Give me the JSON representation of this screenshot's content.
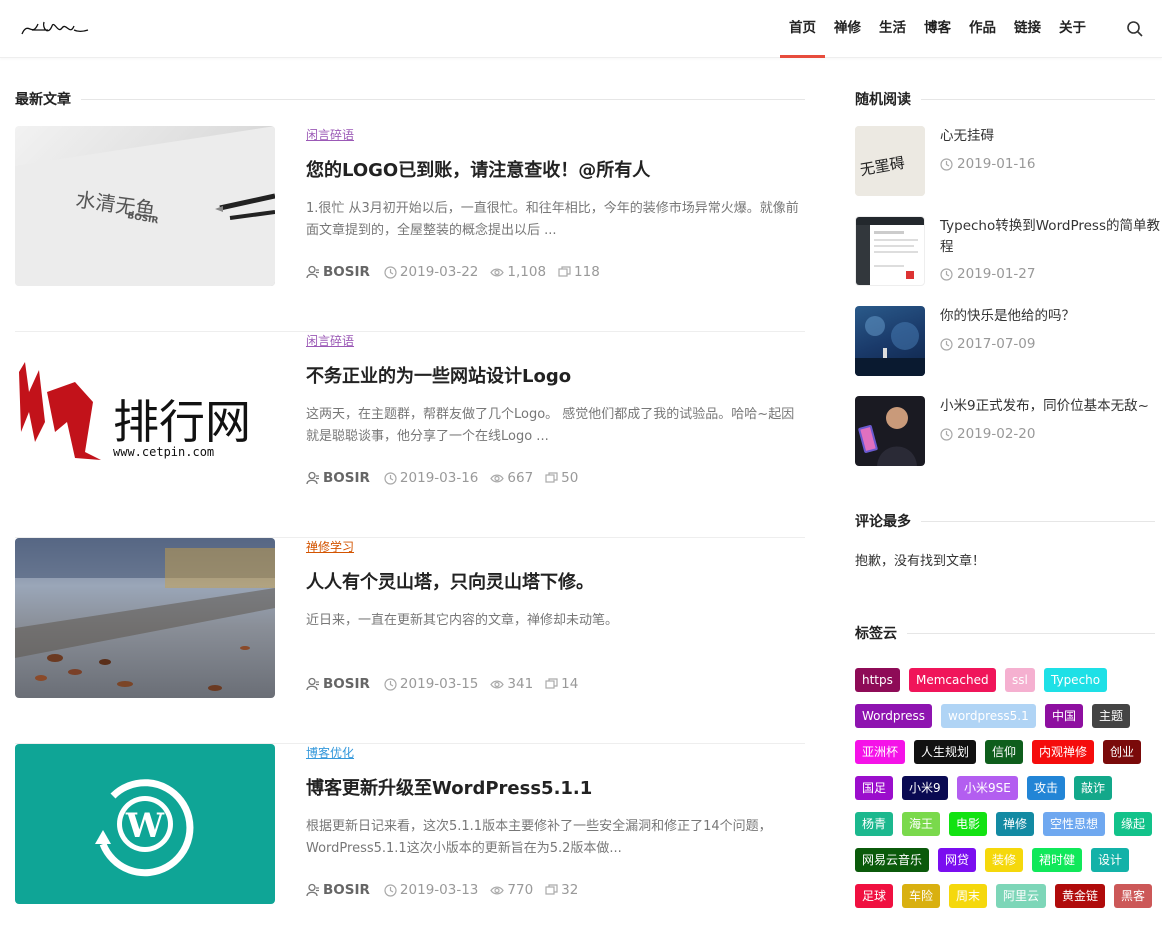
{
  "header": {
    "nav": [
      "首页",
      "禅修",
      "生活",
      "博客",
      "作品",
      "链接",
      "关于"
    ],
    "active_index": 0
  },
  "main": {
    "section_title": "最新文章",
    "posts": [
      {
        "category": "闲言碎语",
        "category_color": "#9b59b6",
        "title": "您的LOGO已到账，请注意查收！@所有人",
        "excerpt": "1.很忙 从3月初开始以后，一直很忙。和往年相比，今年的装修市场异常火爆。就像前面文章提到的，全屋整装的概念提出以后 ...",
        "author": "BOSIR",
        "date": "2019-03-22",
        "views": "1,108",
        "comments": "118",
        "thumb_text": "水清无鱼",
        "thumb_subtext": "BOSIR"
      },
      {
        "category": "闲言碎语",
        "category_color": "#9b59b6",
        "title": "不务正业的为一些网站设计Logo",
        "excerpt": "这两天，在主题群，帮群友做了几个Logo。 感觉他们都成了我的试验品。哈哈~起因就是聪聪谈事，他分享了一个在线Logo ...",
        "author": "BOSIR",
        "date": "2019-03-16",
        "views": "667",
        "comments": "50",
        "thumb_text": "排行网",
        "thumb_subtext": "www.cetpin.com"
      },
      {
        "category": "禅修学习",
        "category_color": "#d35400",
        "title": "人人有个灵山塔，只向灵山塔下修。",
        "excerpt": "近日来，一直在更新其它内容的文章，禅修却未动笔。",
        "author": "BOSIR",
        "date": "2019-03-15",
        "views": "341",
        "comments": "14"
      },
      {
        "category": "博客优化",
        "category_color": "#3498db",
        "title": "博客更新升级至WordPress5.1.1",
        "excerpt": "根据更新日记来看，这次5.1.1版本主要修补了一些安全漏洞和修正了14个问题，WordPress5.1.1这次小版本的更新旨在为5.2版本做...",
        "author": "BOSIR",
        "date": "2019-03-13",
        "views": "770",
        "comments": "32"
      }
    ]
  },
  "sidebar": {
    "random_title": "随机阅读",
    "random_items": [
      {
        "title": "心无挂碍",
        "date": "2019-01-16",
        "thumb_text": "无罣碍"
      },
      {
        "title": "Typecho转换到WordPress的简单教程",
        "date": "2019-01-27"
      },
      {
        "title": "你的快乐是他给的吗？",
        "date": "2017-07-09"
      },
      {
        "title": "小米9正式发布，同价位基本无敌~",
        "date": "2019-02-20"
      }
    ],
    "comments_title": "评论最多",
    "comments_empty": "抱歉，没有找到文章！",
    "tags_title": "标签云",
    "tags": [
      {
        "label": "https",
        "color": "#8e0b57"
      },
      {
        "label": "Memcached",
        "color": "#f0155a"
      },
      {
        "label": "ssl",
        "color": "#f5b0d0"
      },
      {
        "label": "Typecho",
        "color": "#1ee0e6"
      },
      {
        "label": "Wordpress",
        "color": "#8e14b0"
      },
      {
        "label": "wordpress5.1",
        "color": "#b0d4f5"
      },
      {
        "label": "中国",
        "color": "#8e0fa0"
      },
      {
        "label": "主题",
        "color": "#444444"
      },
      {
        "label": "亚洲杯",
        "color": "#f512e8"
      },
      {
        "label": "人生规划",
        "color": "#111111"
      },
      {
        "label": "信仰",
        "color": "#0e5e1c"
      },
      {
        "label": "内观禅修",
        "color": "#f50c0c"
      },
      {
        "label": "创业",
        "color": "#7a0a0a"
      },
      {
        "label": "国足",
        "color": "#9b0ecc"
      },
      {
        "label": "小米9",
        "color": "#0a0a52"
      },
      {
        "label": "小米9SE",
        "color": "#b35ef0"
      },
      {
        "label": "攻击",
        "color": "#2285d6"
      },
      {
        "label": "敲诈",
        "color": "#13a88a"
      },
      {
        "label": "杨青",
        "color": "#1cb88e"
      },
      {
        "label": "海王",
        "color": "#7ad94c"
      },
      {
        "label": "电影",
        "color": "#12e212"
      },
      {
        "label": "禅修",
        "color": "#138aa3"
      },
      {
        "label": "空性思想",
        "color": "#6fa8f0"
      },
      {
        "label": "缘起",
        "color": "#12c28a"
      },
      {
        "label": "网易云音乐",
        "color": "#0b5a0b"
      },
      {
        "label": "网贷",
        "color": "#7a0ef0"
      },
      {
        "label": "装修",
        "color": "#f5d80c"
      },
      {
        "label": "裙时健",
        "color": "#10e85a"
      },
      {
        "label": "设计",
        "color": "#13b2a8"
      },
      {
        "label": "足球",
        "color": "#f01040"
      },
      {
        "label": "车险",
        "color": "#d9b010"
      },
      {
        "label": "周末",
        "color": "#f5d80c"
      },
      {
        "label": "阿里云",
        "color": "#7dd6b8"
      },
      {
        "label": "黄金链",
        "color": "#b00b0b"
      },
      {
        "label": "黑客",
        "color": "#cc5858"
      }
    ]
  },
  "colors": {
    "accent": "#e74c3c",
    "wp_thumb": "#0fa596"
  },
  "icons": {
    "search": "search-icon",
    "author": "user-icon",
    "date": "clock-icon",
    "views": "eye-icon",
    "comments": "comment-icon"
  }
}
